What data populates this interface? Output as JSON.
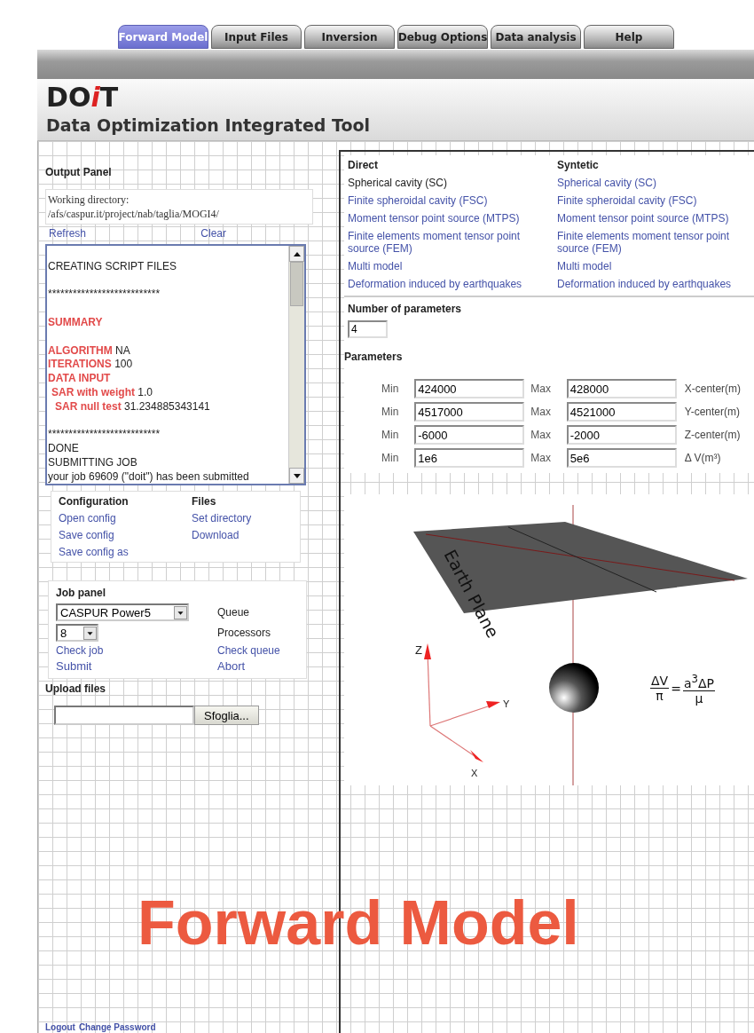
{
  "tabs": [
    {
      "label": "Forward Model",
      "selected": true
    },
    {
      "label": "Input Files",
      "selected": false
    },
    {
      "label": "Inversion",
      "selected": false
    },
    {
      "label": "Debug Options",
      "selected": false
    },
    {
      "label": "Data analysis",
      "selected": false
    },
    {
      "label": "Help",
      "selected": false
    }
  ],
  "header": {
    "logo": [
      {
        "text": "DO",
        "accent": false
      },
      {
        "text": "i",
        "accent": true
      },
      {
        "text": "T",
        "accent": false
      }
    ],
    "subtitle": "Data Optimization Integrated Tool"
  },
  "output_panel": {
    "title": "Output Panel",
    "working_directory": [
      "Working directory:",
      "/afs/caspur.it/project/nab/taglia/MOGI4/"
    ],
    "actions": [
      "Refresh",
      "Clear"
    ],
    "log": [
      {
        "kind": "blank"
      },
      {
        "kind": "plain",
        "text": "CREATING SCRIPT FILES"
      },
      {
        "kind": "blank"
      },
      {
        "kind": "plain",
        "text": "***************************"
      },
      {
        "kind": "blank"
      },
      {
        "kind": "heading",
        "text": "SUMMARY"
      },
      {
        "kind": "blank"
      },
      {
        "kind": "key",
        "key": "ALGORITHM",
        "value": "NA"
      },
      {
        "kind": "key",
        "key": "ITERATIONS",
        "value": "100"
      },
      {
        "kind": "heading",
        "text": "DATA INPUT"
      },
      {
        "kind": "subkey",
        "key": "SAR with weight",
        "value": "1.0"
      },
      {
        "kind": "subsubkey",
        "key": "SAR null test",
        "value": "31.234885343141"
      },
      {
        "kind": "blank"
      },
      {
        "kind": "plain",
        "text": "***************************"
      },
      {
        "kind": "plain",
        "text": "DONE"
      },
      {
        "kind": "plain",
        "text": "SUBMITTING JOB"
      },
      {
        "kind": "plain",
        "text": "your job 69609 (\"doit\") has been submitted"
      }
    ]
  },
  "menus": [
    {
      "title": "Configuration",
      "links": [
        "Open config",
        "Save config",
        "Save config as"
      ]
    },
    {
      "title": "Files",
      "links": [
        "Set directory",
        "Download"
      ]
    }
  ],
  "job_panel": {
    "title": "Job panel",
    "queue": {
      "value": "CASPUR Power5",
      "label": "Queue"
    },
    "processors": {
      "value": "8",
      "label": "Processors"
    },
    "links": [
      "Check job",
      "Check queue",
      "Submit",
      "Abort"
    ]
  },
  "upload": {
    "title": "Upload files",
    "button": "Sfoglia..."
  },
  "footer_links": [
    "Logout",
    "Change Password"
  ],
  "models": {
    "columns": [
      {
        "title": "Direct",
        "items": [
          {
            "label": "Spherical cavity (SC)",
            "selected": true
          },
          {
            "label": "Finite spheroidal cavity (FSC)",
            "selected": false
          },
          {
            "label": "Moment tensor point source (MTPS)",
            "selected": false
          },
          {
            "label": "Finite elements moment tensor point source (FEM)",
            "selected": false
          },
          {
            "label": "Multi model",
            "selected": false
          },
          {
            "label": "Deformation induced by earthquakes",
            "selected": false
          }
        ]
      },
      {
        "title": "Syntetic",
        "items": [
          {
            "label": "Spherical cavity (SC)",
            "selected": false
          },
          {
            "label": "Finite spheroidal cavity (FSC)",
            "selected": false
          },
          {
            "label": "Moment tensor point source (MTPS)",
            "selected": false
          },
          {
            "label": "Finite elements moment tensor point source (FEM)",
            "selected": false
          },
          {
            "label": "Multi model",
            "selected": false
          },
          {
            "label": "Deformation induced by earthquakes",
            "selected": false
          }
        ]
      }
    ]
  },
  "number_of_parameters": {
    "title": "Number of parameters",
    "value": "4"
  },
  "parameters": {
    "title": "Parameters",
    "rows": [
      {
        "min_label": "Min",
        "min": "424000",
        "max_label": "Max",
        "max": "428000",
        "name": "X-center(m)"
      },
      {
        "min_label": "Min",
        "min": "4517000",
        "max_label": "Max",
        "max": "4521000",
        "name": "Y-center(m)"
      },
      {
        "min_label": "Min",
        "min": "-6000",
        "max_label": "Max",
        "max": "-2000",
        "name": "Z-center(m)"
      },
      {
        "min_label": "Min",
        "min": "1e6",
        "max_label": "Max",
        "max": "5e6",
        "name": "Δ V(m³)"
      }
    ]
  },
  "scene": {
    "plane_label": "Earth Plane",
    "axis_labels": [
      "Z",
      "Y",
      "X"
    ],
    "formula": {
      "left_num": "ΔV",
      "left_den": "π",
      "sign": "=",
      "right_num": "a$^{3}$ΔP",
      "right_den": "μ"
    }
  },
  "caption": "Forward Model"
}
